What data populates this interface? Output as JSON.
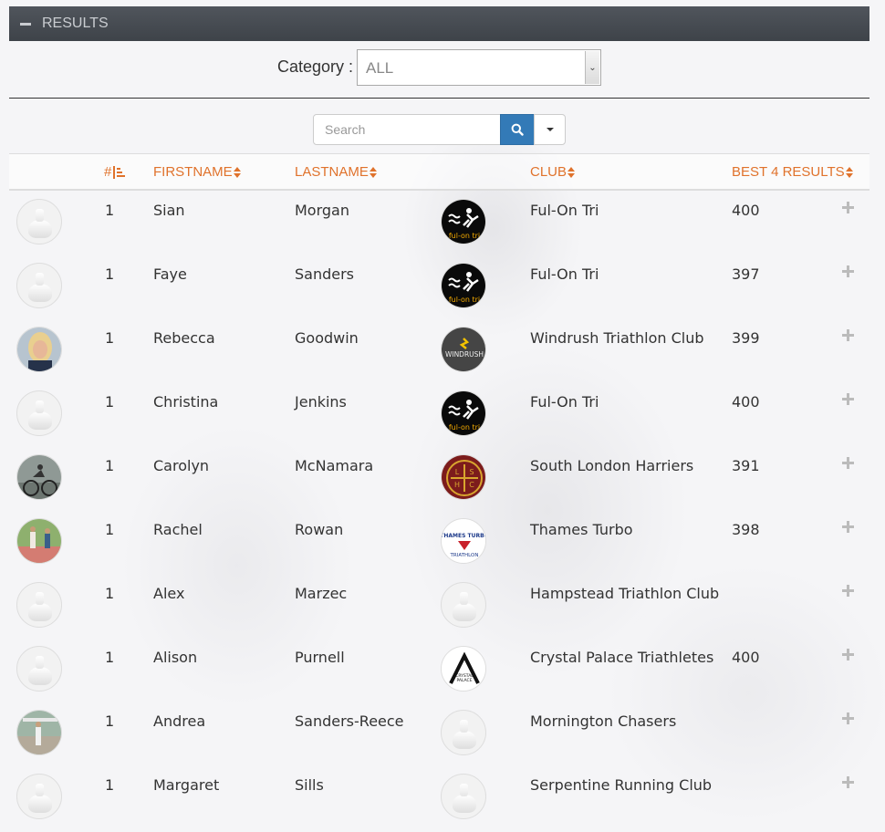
{
  "panel": {
    "title": "RESULTS"
  },
  "filter": {
    "category_label": "Category :",
    "category_value": "ALL"
  },
  "search": {
    "placeholder": "Search",
    "icon": "search-icon"
  },
  "table": {
    "headers": {
      "rank": "#",
      "firstname": "FIRSTNAME",
      "lastname": "LASTNAME",
      "club": "CLUB",
      "best": "BEST 4 RESULTS"
    },
    "rows": [
      {
        "rank": "1",
        "firstname": "Sian",
        "lastname": "Morgan",
        "club": "Ful-On Tri",
        "best": "400",
        "avatar": "placeholder",
        "club_logo": "fulon"
      },
      {
        "rank": "1",
        "firstname": "Faye",
        "lastname": "Sanders",
        "club": "Ful-On Tri",
        "best": "397",
        "avatar": "placeholder",
        "club_logo": "fulon"
      },
      {
        "rank": "1",
        "firstname": "Rebecca",
        "lastname": "Goodwin",
        "club": "Windrush Triathlon Club",
        "best": "399",
        "avatar": "photo-blonde",
        "club_logo": "windrush"
      },
      {
        "rank": "1",
        "firstname": "Christina",
        "lastname": "Jenkins",
        "club": "Ful-On Tri",
        "best": "400",
        "avatar": "placeholder",
        "club_logo": "fulon"
      },
      {
        "rank": "1",
        "firstname": "Carolyn",
        "lastname": "McNamara",
        "club": "South London Harriers",
        "best": "391",
        "avatar": "photo-cyclist",
        "club_logo": "slh"
      },
      {
        "rank": "1",
        "firstname": "Rachel",
        "lastname": "Rowan",
        "club": "Thames Turbo",
        "best": "398",
        "avatar": "photo-runners",
        "club_logo": "thames"
      },
      {
        "rank": "1",
        "firstname": "Alex",
        "lastname": "Marzec",
        "club": "Hampstead Triathlon Club",
        "best": "",
        "avatar": "placeholder",
        "club_logo": "placeholder"
      },
      {
        "rank": "1",
        "firstname": "Alison",
        "lastname": "Purnell",
        "club": "Crystal Palace Triathletes",
        "best": "400",
        "avatar": "placeholder",
        "club_logo": "crystal"
      },
      {
        "rank": "1",
        "firstname": "Andrea",
        "lastname": "Sanders-Reece",
        "club": "Mornington Chasers",
        "best": "",
        "avatar": "photo-race",
        "club_logo": "placeholder"
      },
      {
        "rank": "1",
        "firstname": "Margaret",
        "lastname": "Sills",
        "club": "Serpentine Running Club",
        "best": "",
        "avatar": "placeholder",
        "club_logo": "placeholder"
      }
    ]
  },
  "logos": {
    "fulon_text": "ful-on tri",
    "windrush_text": "WINDRUSH",
    "slh_letters": [
      "L",
      "S",
      "H",
      "C"
    ],
    "thames_text": [
      "THAMES TURBO",
      "TRIATHLON"
    ],
    "crystal_text": [
      "CRYSTAL",
      "PALACE"
    ]
  },
  "colors": {
    "accent": "#e0722b",
    "header_bg": "#474c52",
    "search_btn": "#337ab7"
  }
}
